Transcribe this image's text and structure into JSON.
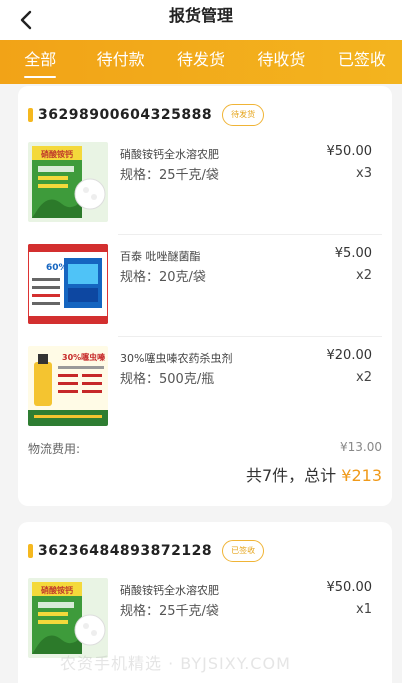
{
  "header": {
    "title": "报货管理"
  },
  "tabs": [
    {
      "label": "全部",
      "active": true
    },
    {
      "label": "待付款",
      "active": false
    },
    {
      "label": "待发货",
      "active": false
    },
    {
      "label": "待收货",
      "active": false
    },
    {
      "label": "已签收",
      "active": false
    }
  ],
  "orders": [
    {
      "order_no": "36298900604325888",
      "status": "待发货",
      "items": [
        {
          "name": "硝酸铵钙全水溶农肥",
          "spec": "规格：25千克/袋",
          "price": "¥50.00",
          "qty": "x3"
        },
        {
          "name": "百泰 吡唑醚菌酯",
          "spec": "规格：20克/袋",
          "price": "¥5.00",
          "qty": "x2"
        },
        {
          "name": "30%噻虫嗪农药杀虫剂",
          "spec": "规格：500克/瓶",
          "price": "¥20.00",
          "qty": "x2"
        }
      ],
      "shipping_label": "物流费用:",
      "shipping_value": "¥13.00",
      "total_prefix": "共7件，总计",
      "total_amount": "¥213"
    },
    {
      "order_no": "36236484893872128",
      "status": "已签收",
      "items": [
        {
          "name": "硝酸铵钙全水溶农肥",
          "spec": "规格：25千克/袋",
          "price": "¥50.00",
          "qty": "x1"
        }
      ]
    }
  ],
  "product_images": {
    "calcium_title": "硝酸铵钙",
    "pyraclostrobin_percent": "60%",
    "thiamethoxam_title": "30%噻虫嗪"
  },
  "watermark": "农资手机精选 · BYJSIXY.COM",
  "colors": {
    "accent": "#f2a317",
    "price_highlight": "#f09a1a"
  }
}
